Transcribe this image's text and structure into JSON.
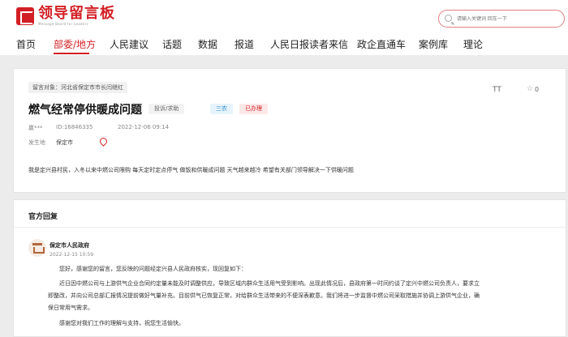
{
  "brand": {
    "name_cn": "领导留言板",
    "name_en": "Message Board for Leaders"
  },
  "search": {
    "placeholder": "请输入关键词 回车一下"
  },
  "nav": {
    "items": [
      "首页",
      "部委/地方",
      "人民建议",
      "话题",
      "数据",
      "报道",
      "人民日报读者来信",
      "政企直通车",
      "案例库",
      "理论"
    ],
    "active_index": 1
  },
  "message": {
    "target": "留言对象：河北省保定市市长闫继红",
    "title": "燃气经常停供暖成问题",
    "category": "投诉/求助",
    "field": "三农",
    "status": "已办理",
    "author": "赢***",
    "id": "ID:16846335",
    "time": "2022-12-06 09:14",
    "location_label": "发生地",
    "location": "保定市",
    "font_icon_label": "TT",
    "favorite_count": "0",
    "content": "我是定兴县村民，入冬以来中燃公司限购 每天定时定点停气 做饭和供暖成问题 天气越来越冷 希望有关部门领导解决一下供暖问题"
  },
  "reply": {
    "section_title": "官方回复",
    "department": "保定市人民政府",
    "time": "2022-12-15 10:59",
    "para1": "您好，感谢您的留言，您反映的问题经定兴县人民政府核实，现回复如下：",
    "para2_line1": "近日因中燃公司与上游供气企业合同约定量未能及时调整供应，导致区域内群众生活用气受到影响。出现此情况后，县政府第一时间约谈了定兴中燃公司负责人，要求立",
    "para2_line2": "即整改，并向公司总部汇报情况提前做好气量补充。目前供气已恢复正常，对给群众生活带来的不便深表歉意。我们将进一步监督中燃公司采取措施并协调上游供气企业，确",
    "para2_line3": "保日常用气需求。",
    "para3": "感谢您对我们工作的理解与支持，祝您生活愉快。"
  },
  "colors": {
    "brand_red": "#d21f25",
    "tag_blue": "#2a89c9",
    "background": "#ececec"
  }
}
